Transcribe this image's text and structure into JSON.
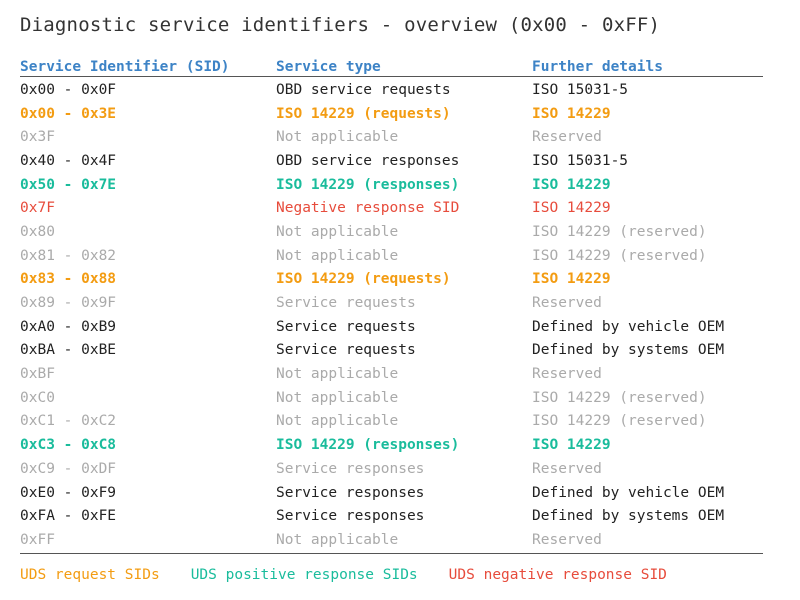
{
  "title": "Diagnostic service identifiers - overview (0x00 - 0xFF)",
  "colors": {
    "header": "#3d83c6",
    "normal": "#222222",
    "muted": "#aaaaaa",
    "request": "#f39c12",
    "positive": "#1abc9c",
    "negative": "#e74c3c"
  },
  "table": {
    "headers": [
      "Service Identifier (SID)",
      "Service type",
      "Further details"
    ],
    "rows": [
      {
        "sid": "0x00 - 0x0F",
        "type": "OBD service requests",
        "details": "ISO 15031-5",
        "style": "normal"
      },
      {
        "sid": "0x00 - 0x3E",
        "type": "ISO 14229 (requests)",
        "details": "ISO 14229",
        "style": "request"
      },
      {
        "sid": "0x3F",
        "type": "Not applicable",
        "details": "Reserved",
        "style": "muted"
      },
      {
        "sid": "0x40 - 0x4F",
        "type": "OBD service responses",
        "details": "ISO 15031-5",
        "style": "normal"
      },
      {
        "sid": "0x50 - 0x7E",
        "type": "ISO 14229 (responses)",
        "details": "ISO 14229",
        "style": "positive"
      },
      {
        "sid": "0x7F",
        "type": "Negative response SID",
        "details": "ISO 14229",
        "style": "negative"
      },
      {
        "sid": "0x80",
        "type": "Not applicable",
        "details": "ISO 14229 (reserved)",
        "style": "muted"
      },
      {
        "sid": "0x81 - 0x82",
        "type": "Not applicable",
        "details": "ISO 14229 (reserved)",
        "style": "muted"
      },
      {
        "sid": "0x83 - 0x88",
        "type": "ISO 14229 (requests)",
        "details": "ISO 14229",
        "style": "request"
      },
      {
        "sid": "0x89 - 0x9F",
        "type": "Service requests",
        "details": "Reserved",
        "style": "muted"
      },
      {
        "sid": "0xA0 - 0xB9",
        "type": "Service requests",
        "details": "Defined by vehicle OEM",
        "style": "normal"
      },
      {
        "sid": "0xBA - 0xBE",
        "type": "Service requests",
        "details": "Defined by systems OEM",
        "style": "normal"
      },
      {
        "sid": "0xBF",
        "type": "Not applicable",
        "details": "Reserved",
        "style": "muted"
      },
      {
        "sid": "0xC0",
        "type": "Not applicable",
        "details": "ISO 14229 (reserved)",
        "style": "muted"
      },
      {
        "sid": "0xC1 - 0xC2",
        "type": "Not applicable",
        "details": "ISO 14229 (reserved)",
        "style": "muted"
      },
      {
        "sid": "0xC3 - 0xC8",
        "type": "ISO 14229 (responses)",
        "details": "ISO 14229",
        "style": "positive"
      },
      {
        "sid": "0xC9 - 0xDF",
        "type": "Service responses",
        "details": "Reserved",
        "style": "muted"
      },
      {
        "sid": "0xE0 - 0xF9",
        "type": "Service responses",
        "details": "Defined by vehicle OEM",
        "style": "normal"
      },
      {
        "sid": "0xFA - 0xFE",
        "type": "Service responses",
        "details": "Defined by systems OEM",
        "style": "normal"
      },
      {
        "sid": "0xFF",
        "type": "Not applicable",
        "details": "Reserved",
        "style": "muted"
      }
    ]
  },
  "legend": [
    {
      "label": "UDS request SIDs",
      "style": "request"
    },
    {
      "label": "UDS positive response SIDs",
      "style": "positive"
    },
    {
      "label": "UDS negative response SID",
      "style": "negative"
    }
  ]
}
